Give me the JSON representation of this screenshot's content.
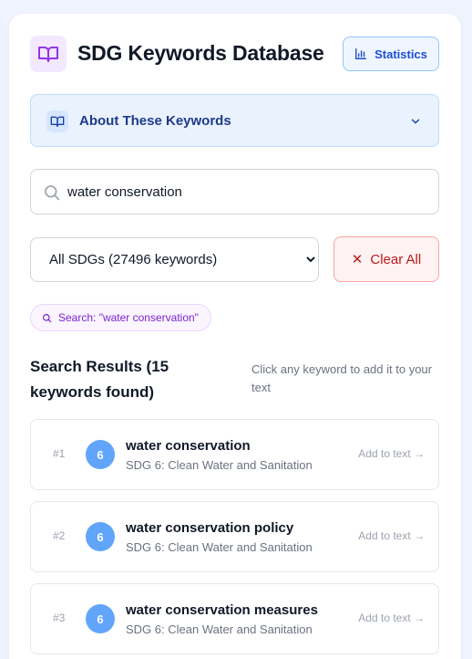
{
  "app": {
    "title": "SDG Keywords Database",
    "statistics_label": "Statistics"
  },
  "about": {
    "label": "About These Keywords"
  },
  "search": {
    "value": "water conservation"
  },
  "filter": {
    "selected": "All SDGs (27496 keywords)",
    "clear_label": "Clear All"
  },
  "active_filters": {
    "search_chip": "Search: \"water conservation\""
  },
  "results": {
    "heading": "Search Results (15 keywords found)",
    "hint": "Click any keyword to add it to your text",
    "items": [
      {
        "rank": "#1",
        "sdg": "6",
        "keyword": "water conservation",
        "sdg_label": "SDG 6: Clean Water and Sanitation",
        "action": "Add to text →"
      },
      {
        "rank": "#2",
        "sdg": "6",
        "keyword": "water conservation policy",
        "sdg_label": "SDG 6: Clean Water and Sanitation",
        "action": "Add to text →"
      },
      {
        "rank": "#3",
        "sdg": "6",
        "keyword": "water conservation measures",
        "sdg_label": "SDG 6: Clean Water and Sanitation",
        "action": "Add to text →"
      }
    ]
  },
  "colors": {
    "accent": "#1d4ed8",
    "sdg6_badge": "#60a5fa",
    "logo_purple": "#9333ea",
    "danger": "#b91c1c"
  },
  "icons": {
    "logo": "open-book-icon",
    "statistics": "bar-chart-icon",
    "about": "book-icon",
    "chevron": "chevron-down-icon",
    "search": "search-icon",
    "clear": "x-icon"
  }
}
